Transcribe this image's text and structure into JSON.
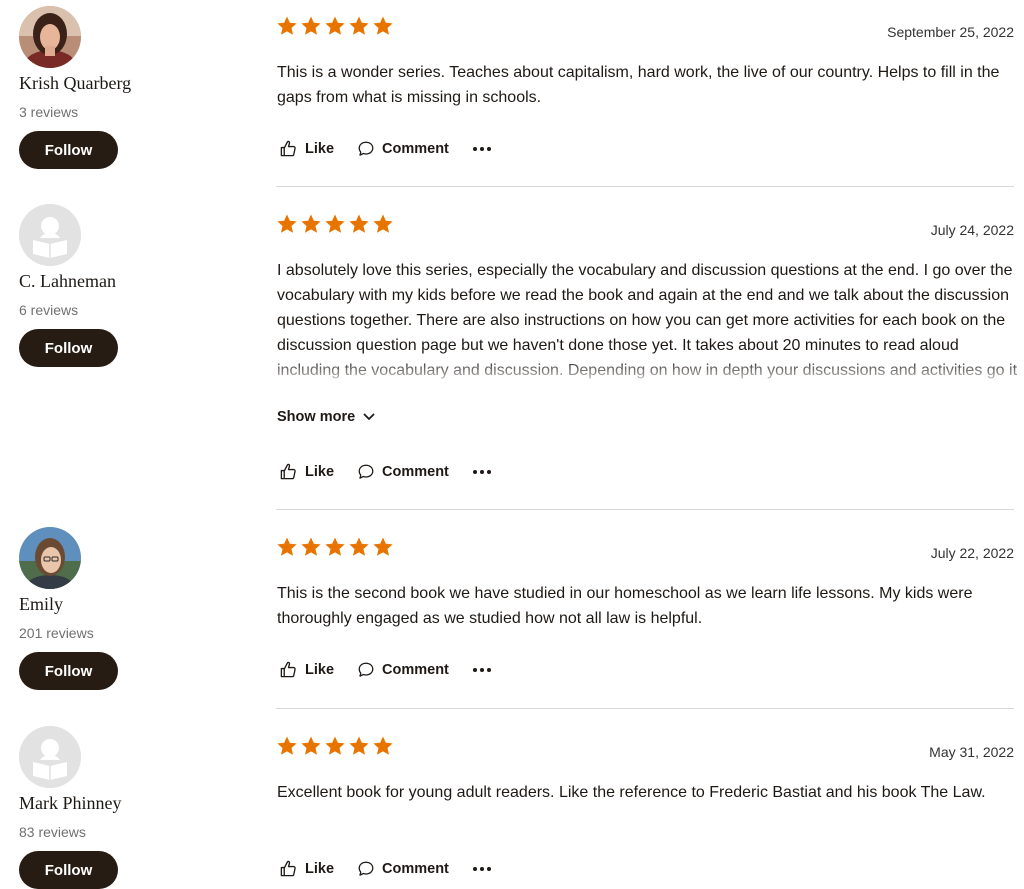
{
  "colors": {
    "star": "#e87400",
    "follow_bg": "#271c14",
    "divider": "#d8d8d8"
  },
  "labels": {
    "follow": "Follow",
    "like": "Like",
    "comment": "Comment",
    "show_more": "Show more"
  },
  "icons": {
    "like": "thumbs-up-icon",
    "comment": "speech-bubble-icon",
    "more": "ellipsis-icon",
    "show_more": "chevron-down-icon"
  },
  "reviews": [
    {
      "reviewer": "Krish Quarberg",
      "review_count": "3 reviews",
      "avatar": "photo",
      "rating": 5,
      "date": "September 25, 2022",
      "text": "This is a wonder series. Teaches about capitalism, hard work, the live of our country. Helps to fill in the gaps from what is missing in schools."
    },
    {
      "reviewer": "C. Lahneman",
      "review_count": "6 reviews",
      "avatar": "default-reader-icon",
      "rating": 5,
      "date": "July 24, 2022",
      "text": "I absolutely love this series, especially the vocabulary and discussion questions at the end. I go over the vocabulary with my kids before we read the book and again at the end and we talk about the discussion questions together. There are also instructions on how you can get more activities for each book on the discussion question page but we haven't done those yet. It takes about 20 minutes to read aloud including the vocabulary and discussion. Depending on how in depth your discussions and activities go it could take longer. It's summer so this first read",
      "truncated": true
    },
    {
      "reviewer": "Emily",
      "review_count": "201 reviews",
      "avatar": "photo",
      "rating": 5,
      "date": "July 22, 2022",
      "text": "This is the second book we have studied in our homeschool as we learn life lessons. My kids were thoroughly engaged as we studied how not all law is helpful."
    },
    {
      "reviewer": "Mark Phinney",
      "review_count": "83 reviews",
      "avatar": "default-reader-icon",
      "rating": 5,
      "date": "May 31, 2022",
      "text": "Excellent book for young adult readers. Like the reference to Frederic Bastiat and his book The Law."
    }
  ]
}
